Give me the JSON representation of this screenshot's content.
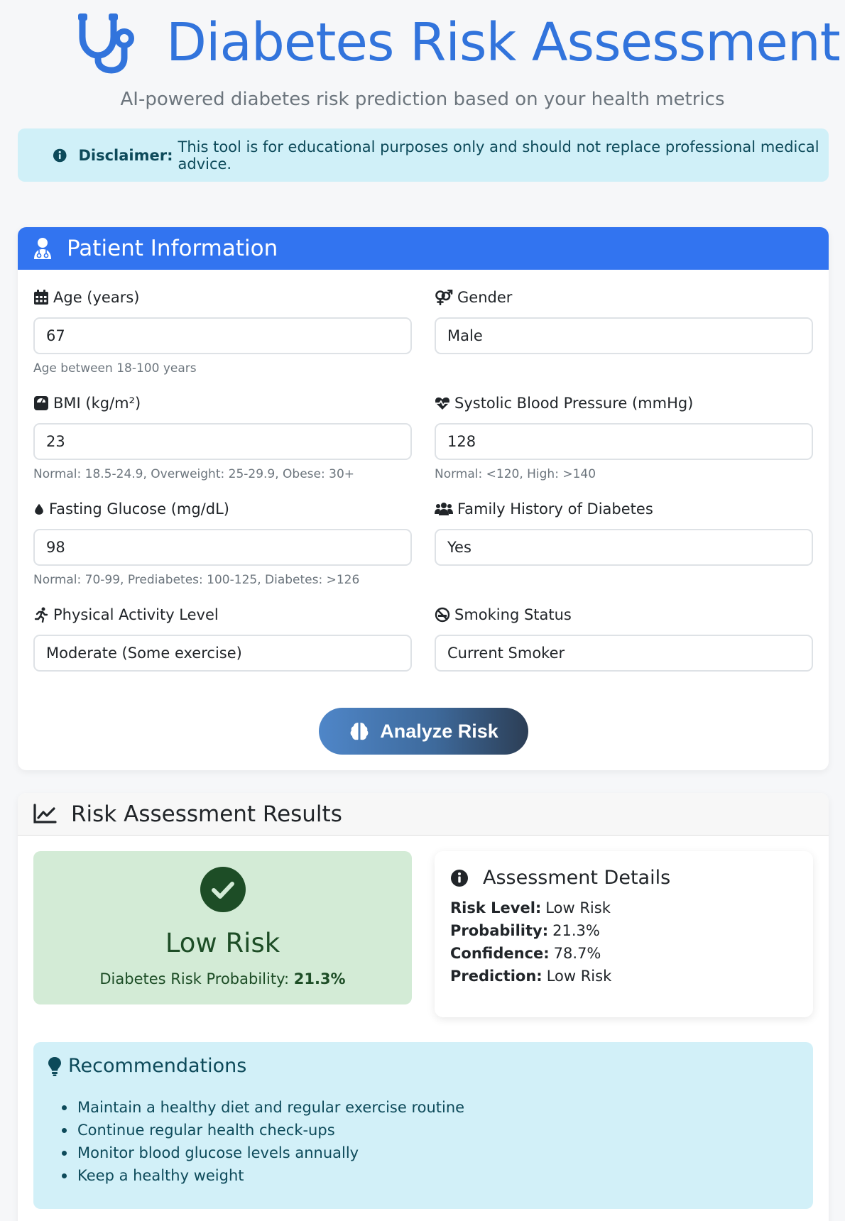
{
  "header": {
    "title": "Diabetes Risk Assessment",
    "subtitle": "AI-powered diabetes risk prediction based on your health metrics",
    "icon": "stethoscope-icon",
    "accent_color": "#3274dc"
  },
  "disclaimer": {
    "label": "Disclaimer:",
    "text": "This tool is for educational purposes only and should not replace professional medical advice.",
    "icon": "info-circle-icon"
  },
  "patient_form": {
    "title": "Patient Information",
    "icon": "user-doctor-icon",
    "header_color": "#3274f0",
    "fields": {
      "age": {
        "label": "Age (years)",
        "value": "67",
        "hint": "Age between 18-100 years",
        "icon": "calendar-icon"
      },
      "gender": {
        "label": "Gender",
        "value": "Male",
        "icon": "venus-mars-icon"
      },
      "bmi": {
        "label": "BMI (kg/m²)",
        "value": "23",
        "hint": "Normal: 18.5-24.9, Overweight: 25-29.9, Obese: 30+",
        "icon": "weight-scale-icon"
      },
      "blood_pressure": {
        "label": "Systolic Blood Pressure (mmHg)",
        "value": "128",
        "hint": "Normal: <120, High: >140",
        "icon": "heart-pulse-icon"
      },
      "glucose": {
        "label": "Fasting Glucose (mg/dL)",
        "value": "98",
        "hint": "Normal: 70-99, Prediabetes: 100-125, Diabetes: >126",
        "icon": "droplet-icon"
      },
      "family_history": {
        "label": "Family History of Diabetes",
        "value": "Yes",
        "icon": "users-icon"
      },
      "activity": {
        "label": "Physical Activity Level",
        "value": "Moderate (Some exercise)",
        "icon": "running-icon"
      },
      "smoking": {
        "label": "Smoking Status",
        "value": "Current Smoker",
        "icon": "ban-smoking-icon"
      }
    },
    "submit_label": "Analyze Risk",
    "submit_icon": "brain-icon"
  },
  "results": {
    "title": "Risk Assessment Results",
    "icon": "chart-line-icon",
    "summary": {
      "level": "Low Risk",
      "probability_label": "Diabetes Risk Probability:",
      "probability_value": "21.3%",
      "icon": "check-circle-icon",
      "color": "#1d4d26"
    },
    "details": {
      "title": "Assessment Details",
      "icon": "info-circle-icon",
      "rows": [
        {
          "label": "Risk Level:",
          "value": "Low Risk"
        },
        {
          "label": "Probability:",
          "value": "21.3%"
        },
        {
          "label": "Confidence:",
          "value": "78.7%"
        },
        {
          "label": "Prediction:",
          "value": "Low Risk"
        }
      ]
    },
    "recommendations": {
      "title": "Recommendations",
      "icon": "lightbulb-icon",
      "items": [
        "Maintain a healthy diet and regular exercise routine",
        "Continue regular health check-ups",
        "Monitor blood glucose levels annually",
        "Keep a healthy weight"
      ]
    }
  }
}
